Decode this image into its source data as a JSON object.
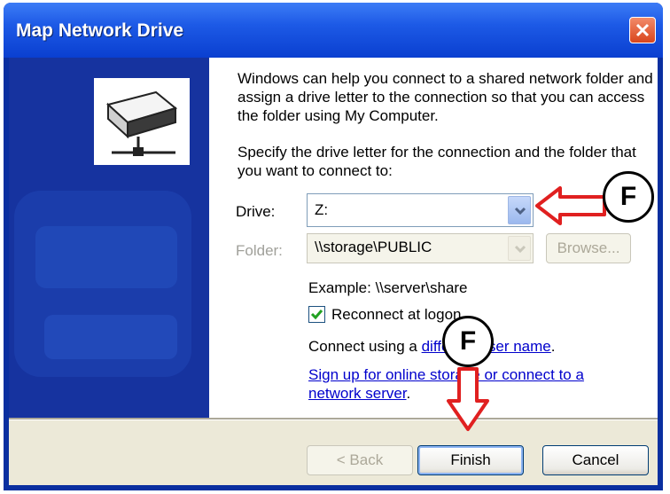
{
  "window": {
    "title": "Map Network Drive"
  },
  "intro_text": "Windows can help you connect to a shared network folder and assign a drive letter to the connection so that you can access the folder using My Computer.",
  "instruction_text": "Specify the drive letter for the connection and the folder that you want to connect to:",
  "drive": {
    "label": "Drive:",
    "value": "Z:"
  },
  "folder": {
    "label": "Folder:",
    "value": "\\\\storage\\PUBLIC",
    "browse_label": "Browse..."
  },
  "example_text": "Example: \\\\server\\share",
  "reconnect": {
    "label": "Reconnect at logon",
    "checked": true
  },
  "connect_as": {
    "prefix": "Connect using a ",
    "link": "different user name",
    "suffix": "."
  },
  "online_storage_link": {
    "line1": "Sign up for online storage or connect to a",
    "line2": "network server"
  },
  "online_storage_suffix": ".",
  "buttons": {
    "back": "< Back",
    "finish": "Finish",
    "cancel": "Cancel"
  },
  "annotations": {
    "drive_marker": "F",
    "finish_marker": "F"
  },
  "colors": {
    "titlebar": "#0a3fd0",
    "annotation_arrow": "#e02020",
    "link": "#0000cc"
  }
}
